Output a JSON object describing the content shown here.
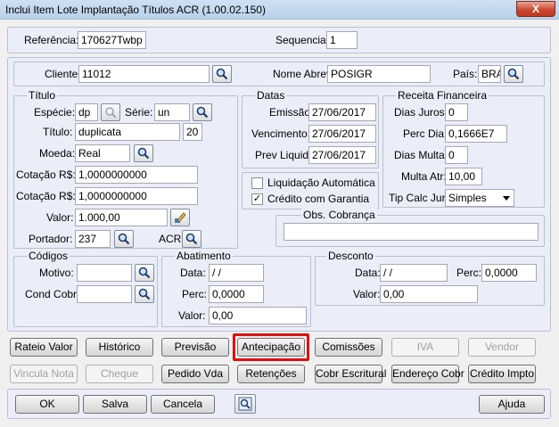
{
  "window": {
    "title": "Inclui Item Lote Implantação Títulos ACR (1.00.02.150)",
    "close_label": "X"
  },
  "header": {
    "referencia_label": "Referência:",
    "referencia_value": "170627Twbp",
    "sequencia_label": "Sequencia:",
    "sequencia_value": "1"
  },
  "cliente": {
    "cliente_label": "Cliente:",
    "cliente_value": "11012",
    "nome_abrev_label": "Nome Abrev:",
    "nome_abrev_value": "POSIGR",
    "pais_label": "País:",
    "pais_value": "BRA"
  },
  "titulo": {
    "legend": "Título",
    "especie_label": "Espécie:",
    "especie_value": "dp",
    "serie_label": "Série:",
    "serie_value": "un",
    "titulo_label": "Título:",
    "titulo_value": "duplicata",
    "parcela_value": "20",
    "moeda_label": "Moeda:",
    "moeda_value": "Real",
    "cotacao1_label": "Cotação R$:",
    "cotacao1_value": "1,0000000000",
    "cotacao2_label": "Cotação R$:",
    "cotacao2_value": "1,0000000000",
    "valor_label": "Valor:",
    "valor_value": "1.000,00",
    "portador_label": "Portador:",
    "portador_value": "237",
    "acr_label": "ACR"
  },
  "datas": {
    "legend": "Datas",
    "emissao_label": "Emissão:",
    "emissao_value": "27/06/2017",
    "vencimento_label": "Vencimento:",
    "vencimento_value": "27/06/2017",
    "prev_liquid_label": "Prev Liquid:",
    "prev_liquid_value": "27/06/2017"
  },
  "receita": {
    "legend": "Receita Financeira",
    "dias_juros_label": "Dias Juros:",
    "dias_juros_value": "0",
    "perc_dia_label": "Perc Dia:",
    "perc_dia_value": "0,1666E7",
    "dias_multa_label": "Dias Multa:",
    "dias_multa_value": "0",
    "multa_atr_label": "Multa Atr:",
    "multa_atr_value": "10,00",
    "tip_calc_label": "Tip Calc Jur:",
    "tip_calc_value": "Simples"
  },
  "checks": {
    "liquidacao_label": "Liquidação Automática",
    "liquidacao_checked": false,
    "credito_label": "Crédito com Garantia",
    "credito_checked": true,
    "check_mark": "✓"
  },
  "obs": {
    "legend": "Obs. Cobrança",
    "value": ""
  },
  "codigos": {
    "legend": "Códigos",
    "motivo_label": "Motivo:",
    "motivo_value": "",
    "cond_cobr_label": "Cond Cobr:",
    "cond_cobr_value": ""
  },
  "abatimento": {
    "legend": "Abatimento",
    "data_label": "Data:",
    "data_value": " / /",
    "perc_label": "Perc:",
    "perc_value": "0,0000",
    "valor_label": "Valor:",
    "valor_value": "0,00"
  },
  "desconto": {
    "legend": "Desconto",
    "data_label": "Data:",
    "data_value": " / /",
    "perc_label": "Perc:",
    "perc_value": "0,0000",
    "valor_label": "Valor:",
    "valor_value": "0,00"
  },
  "actions_row1": {
    "rateio": "Rateio Valor",
    "historico": "Histórico",
    "previsao": "Previsão",
    "antecipacao": "Antecipação",
    "comissoes": "Comissões",
    "iva": "IVA",
    "vendor": "Vendor"
  },
  "actions_row2": {
    "vincula": "Vincula Nota",
    "cheque": "Cheque",
    "pedido": "Pedido Vda",
    "retencoes": "Retenções",
    "cobr_escritural": "Cobr Escritural",
    "endereco": "Endereço Cobr",
    "credito_impto": "Crédito Impto"
  },
  "footer": {
    "ok": "OK",
    "salva": "Salva",
    "cancela": "Cancela",
    "ajuda": "Ajuda"
  },
  "colors": {
    "highlight": "#e01010",
    "panel": "#ebeef8"
  },
  "icons": {
    "search": "search-icon",
    "zoom": "zoom-icon",
    "calculator": "edit-value-icon",
    "help": "help-icon"
  }
}
